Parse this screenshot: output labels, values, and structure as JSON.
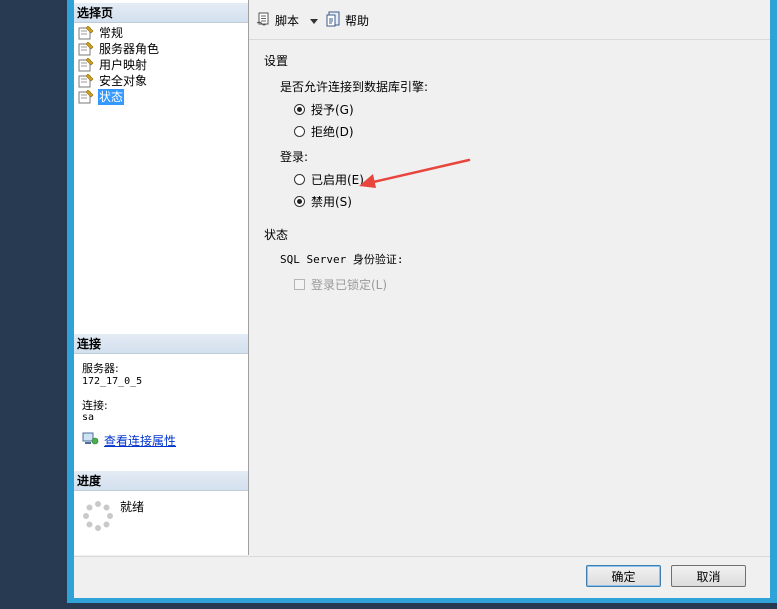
{
  "left_panel": {
    "select_page_header": "选择页",
    "pages": [
      {
        "label": "常规",
        "icon": "page-wrench-icon"
      },
      {
        "label": "服务器角色",
        "icon": "page-wrench-icon"
      },
      {
        "label": "用户映射",
        "icon": "page-wrench-icon"
      },
      {
        "label": "安全对象",
        "icon": "page-wrench-icon"
      },
      {
        "label": "状态",
        "icon": "page-wrench-icon",
        "selected": true
      }
    ],
    "connection": {
      "header": "连接",
      "server_label": "服务器:",
      "server_value": "172_17_0_5",
      "connection_label": "连接:",
      "connection_value": "sa",
      "view_properties_link": "查看连接属性"
    },
    "progress": {
      "header": "进度",
      "status": "就绪"
    }
  },
  "toolbar": {
    "script_label": "脚本",
    "help_label": "帮助"
  },
  "main": {
    "settings_title": "设置",
    "permission_question": "是否允许连接到数据库引擎:",
    "grant_label": "授予(G)",
    "deny_label": "拒绝(D)",
    "login_label": "登录:",
    "enabled_label": "已启用(E)",
    "disabled_label": "禁用(S)",
    "status_title": "状态",
    "sql_auth_label": "SQL Server 身份验证:",
    "locked_out_label": "登录已锁定(L)",
    "selected_permission": "grant",
    "selected_login": "disabled"
  },
  "footer": {
    "ok_label": "确定",
    "cancel_label": "取消"
  },
  "colors": {
    "window_border": "#2fa3d8",
    "desktop": "#283a52",
    "selection": "#3399ff",
    "annotation_arrow": "#e8453c",
    "link": "#0033cc"
  }
}
